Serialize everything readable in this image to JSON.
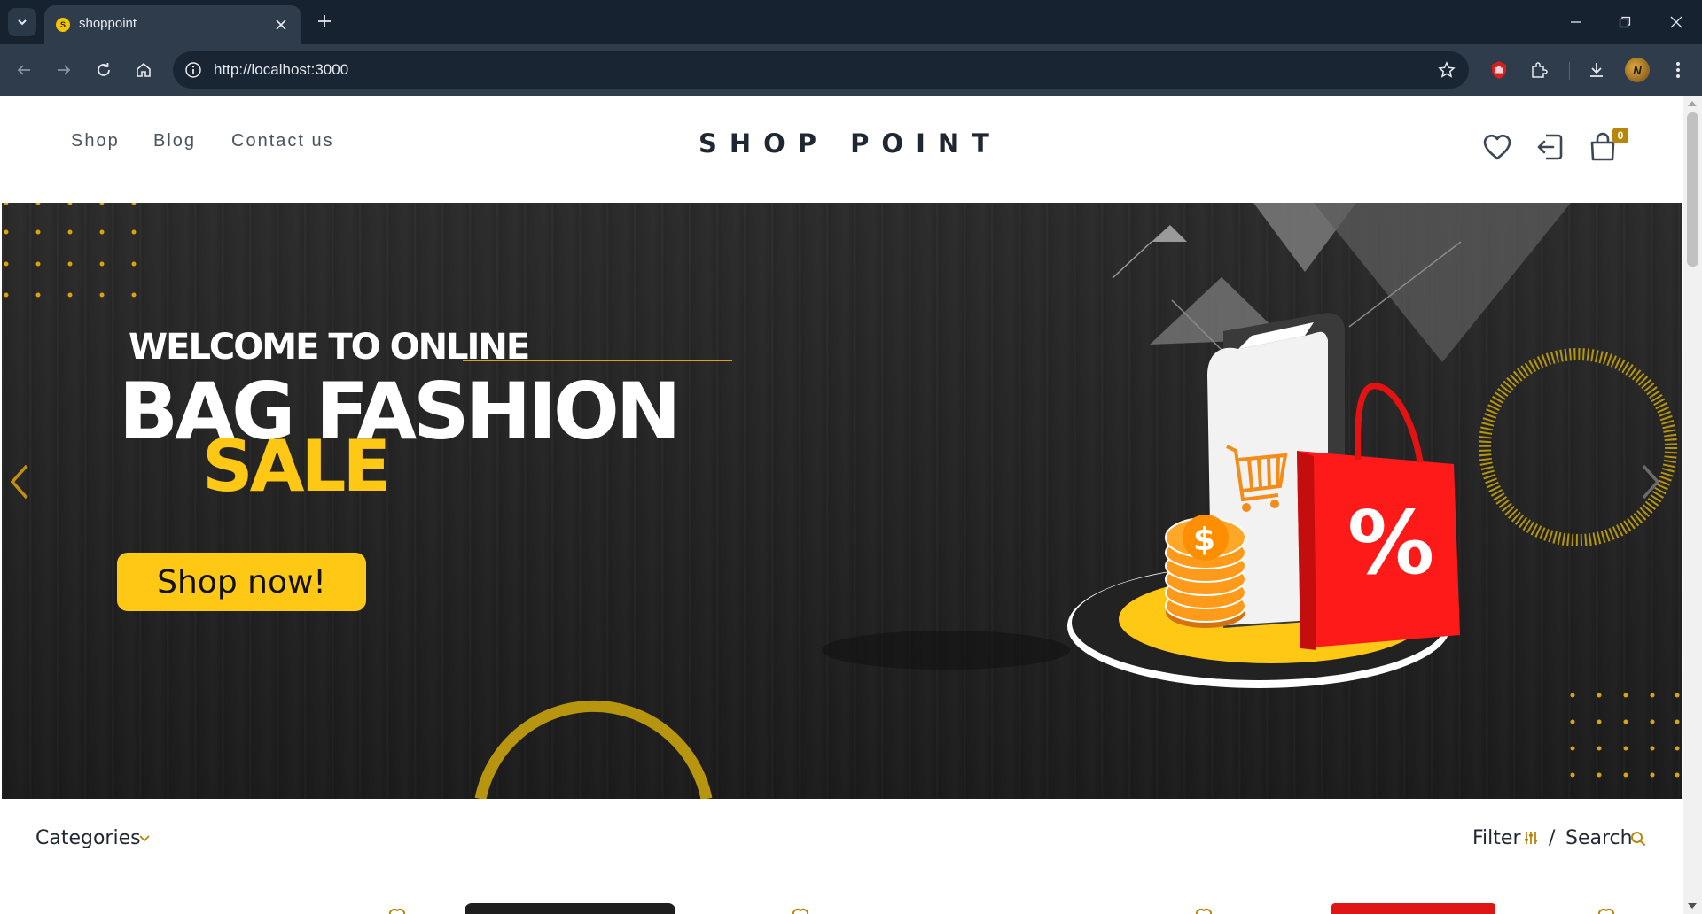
{
  "browser": {
    "tab_title": "shoppoint",
    "url": "http://localhost:3000",
    "profile_initial": "N"
  },
  "site": {
    "nav": [
      "Shop",
      "Blog",
      "Contact us"
    ],
    "logo": "SHOP POINT",
    "cart_count": "0",
    "icons": [
      "heart-icon",
      "login-icon",
      "bag-icon"
    ]
  },
  "hero": {
    "line1": "WELCOME TO ONLINE",
    "line2": "BAG FASHION",
    "line3": "SALE",
    "button": "Shop now!",
    "colors": {
      "accent": "#ffc815",
      "bag": "#ff1a1a",
      "background": "#242424"
    }
  },
  "catalog": {
    "categories_label": "Categories",
    "filter_label": "Filter",
    "separator": "/",
    "search_label": "Search",
    "accent": "#b8860b"
  }
}
